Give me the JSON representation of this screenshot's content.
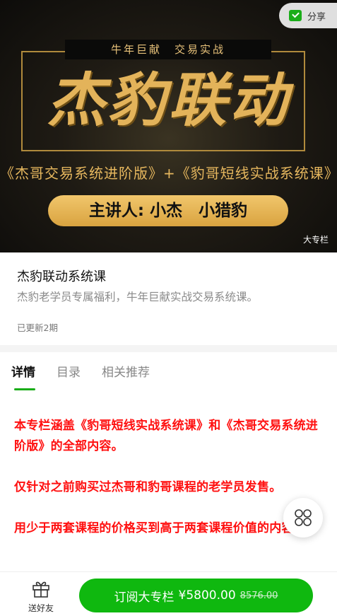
{
  "banner": {
    "top_line": "牛年巨献　交易实战",
    "big_title": "杰豹联动",
    "sub_courses": "《杰哥交易系统进阶版》+《豹哥短线实战系统课》",
    "lecturer": "主讲人: 小杰　小猎豹",
    "tag": "大专栏"
  },
  "share": {
    "label": "分享",
    "icon": "wechat-share-icon"
  },
  "course": {
    "title": "杰豹联动系统课",
    "description": "杰豹老学员专属福利，牛年巨献实战交易系统课。",
    "update_count": "已更新2期"
  },
  "tabs": [
    {
      "label": "详情",
      "active": true
    },
    {
      "label": "目录",
      "active": false
    },
    {
      "label": "相关推荐",
      "active": false
    }
  ],
  "content": {
    "paragraphs": [
      "本专栏涵盖《豹哥短线实战系统课》和《杰哥交易系统进阶版》的全部内容。",
      "仅针对之前购买过杰哥和豹哥课程的老学员发售。",
      "用少于两套课程的价格买到高于两套课程价值的内容~"
    ]
  },
  "bottom_bar": {
    "gift_label": "送好友",
    "subscribe_label": "订阅大专栏",
    "price": "¥5800.00",
    "original_price": "8576.00"
  },
  "colors": {
    "accent_green": "#0fb80f",
    "content_red": "#ff1010",
    "banner_gold": "#e3b35a"
  }
}
